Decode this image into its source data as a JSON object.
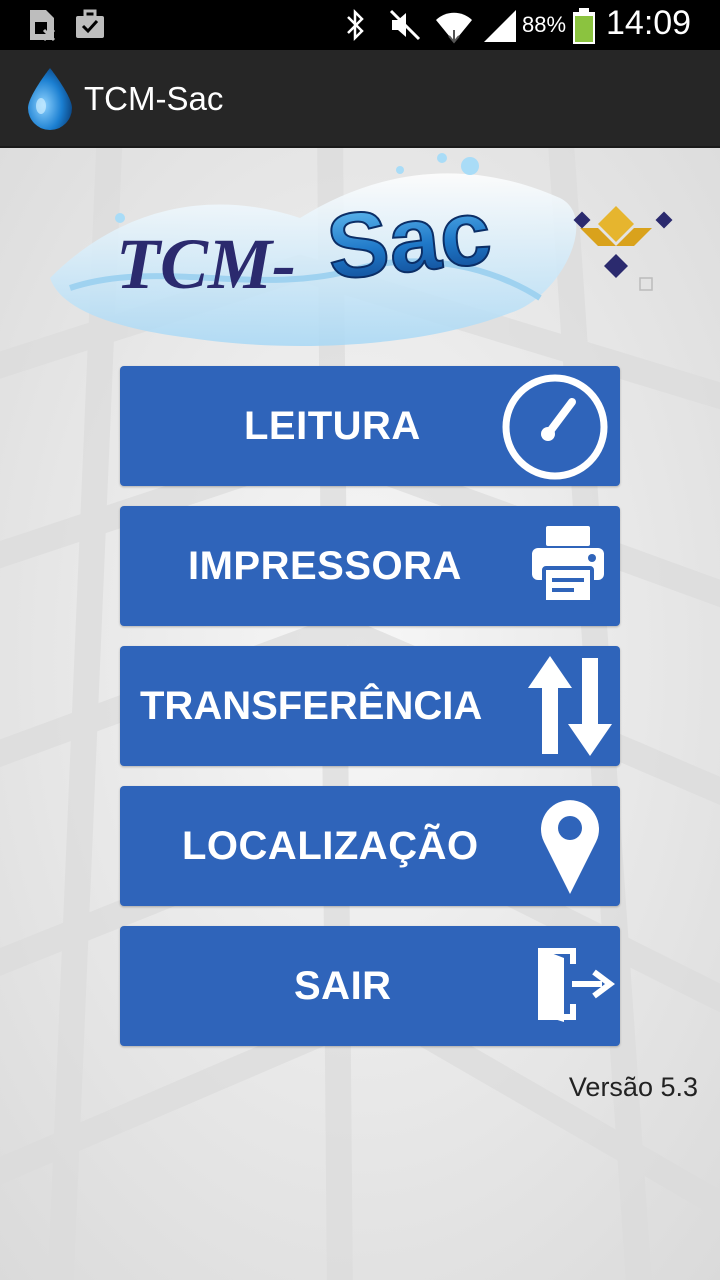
{
  "status_bar": {
    "battery_percent": "88%",
    "time": "14:09",
    "icons": [
      "sim-warning-icon",
      "briefcase-check-icon",
      "bluetooth-icon",
      "mute-icon",
      "wifi-icon",
      "signal-icon",
      "battery-icon"
    ]
  },
  "action_bar": {
    "title": "TCM-Sac",
    "icon": "water-drop-icon"
  },
  "logo": {
    "text_left": "TCM-",
    "text_right": "Sac"
  },
  "menu": [
    {
      "label": "LEITURA",
      "icon": "gauge-icon"
    },
    {
      "label": "IMPRESSORA",
      "icon": "printer-icon"
    },
    {
      "label": "TRANSFERÊNCIA",
      "icon": "up-down-arrows-icon"
    },
    {
      "label": "LOCALIZAÇÃO",
      "icon": "map-pin-icon"
    },
    {
      "label": "SAIR",
      "icon": "exit-door-icon"
    }
  ],
  "version": "Versão 5.3",
  "colors": {
    "button": "#2f64ba",
    "action_bar": "#262626",
    "status_bar": "#000000",
    "logo_dark": "#2b2a6e",
    "logo_blue": "#2e86d6",
    "battery": "#8bc33f"
  }
}
